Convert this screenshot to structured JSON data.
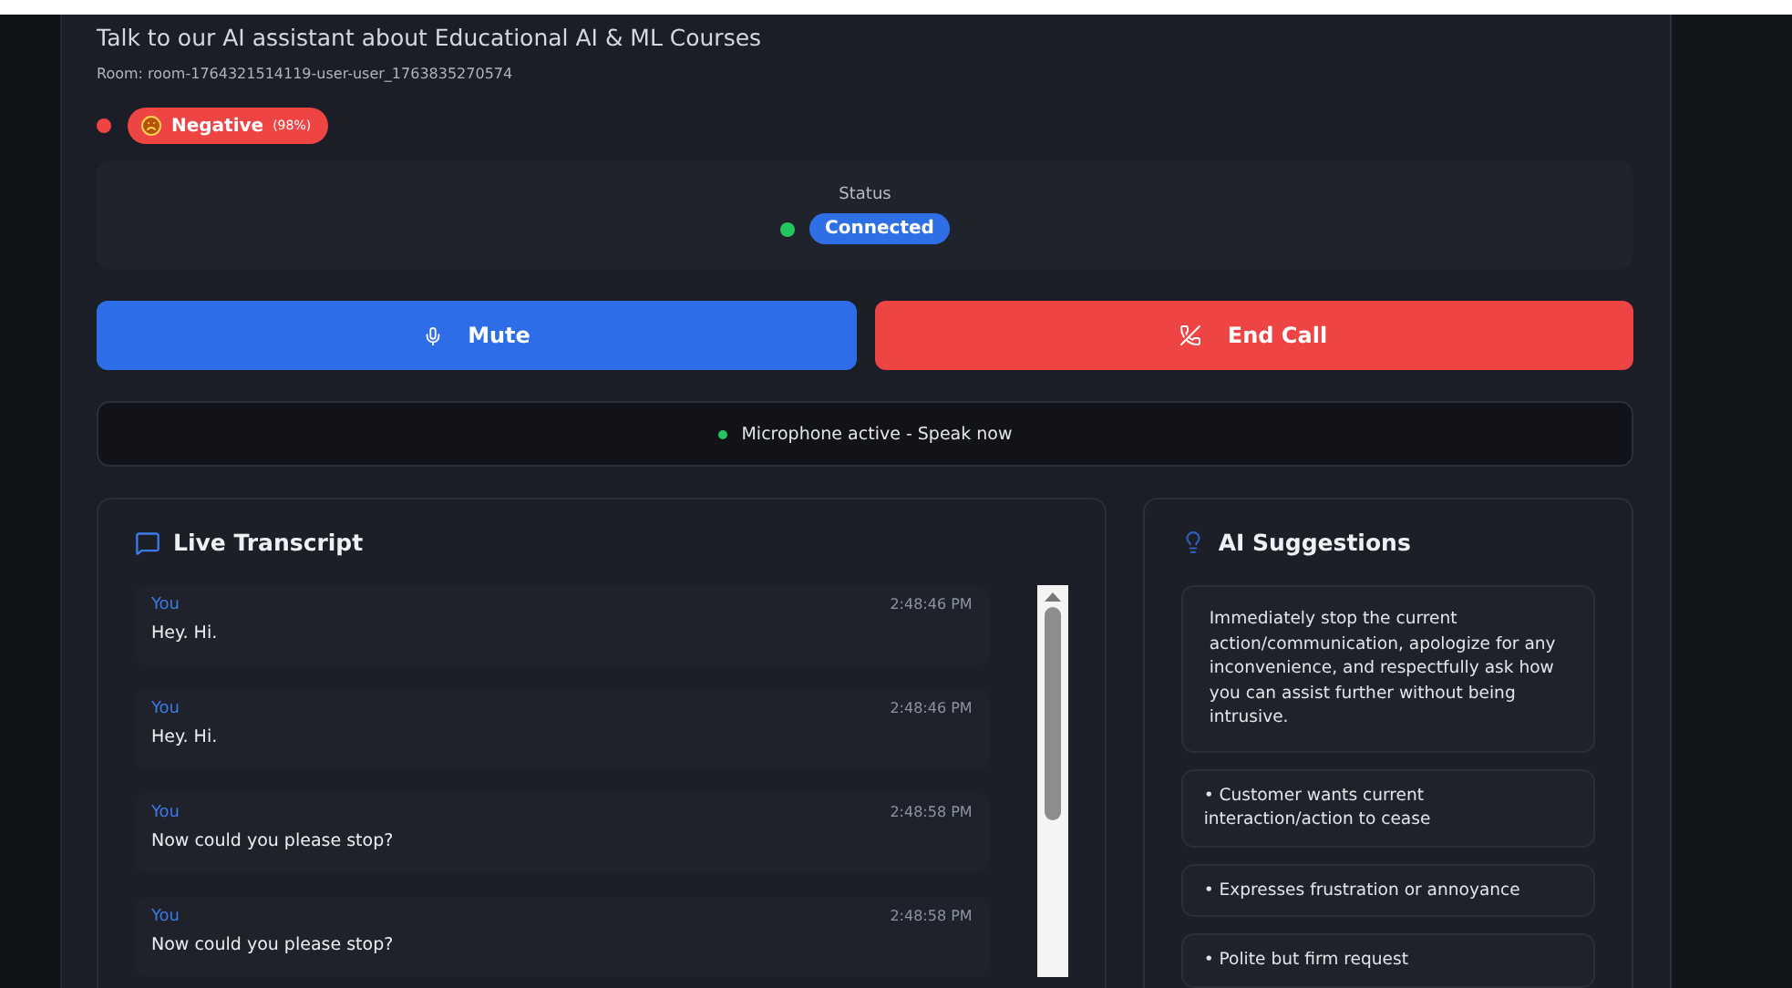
{
  "header": {
    "title": "Talk to our AI assistant about Educational AI & ML Courses",
    "room": "Room: room-1764321514119-user-user_1763835270574"
  },
  "sentiment": {
    "label": "Negative",
    "percent": "(98%)",
    "color": "#ef4444"
  },
  "status": {
    "label": "Status",
    "value": "Connected",
    "color": "#22c55e"
  },
  "buttons": [
    {
      "kind": "mute",
      "label": "Mute"
    },
    {
      "kind": "end",
      "label": "End Call"
    }
  ],
  "mic_status": {
    "text": "Microphone active - Speak now",
    "color": "#22c55e"
  },
  "transcript": {
    "title": "Live Transcript",
    "messages": [
      {
        "speaker": "You",
        "time": "2:48:46 PM",
        "text": "Hey. Hi."
      },
      {
        "speaker": "You",
        "time": "2:48:46 PM",
        "text": "Hey. Hi."
      },
      {
        "speaker": "You",
        "time": "2:48:58 PM",
        "text": "Now could you please stop?"
      },
      {
        "speaker": "You",
        "time": "2:48:58 PM",
        "text": "Now could you please stop?"
      }
    ]
  },
  "suggestions": {
    "title": "AI Suggestions",
    "items": [
      "Immediately stop the current action/communication, apologize for any inconvenience, and respectfully ask how you can assist further without being intrusive.",
      "• Customer wants current interaction/action to cease",
      "• Expresses frustration or annoyance",
      "• Polite but firm request"
    ]
  }
}
